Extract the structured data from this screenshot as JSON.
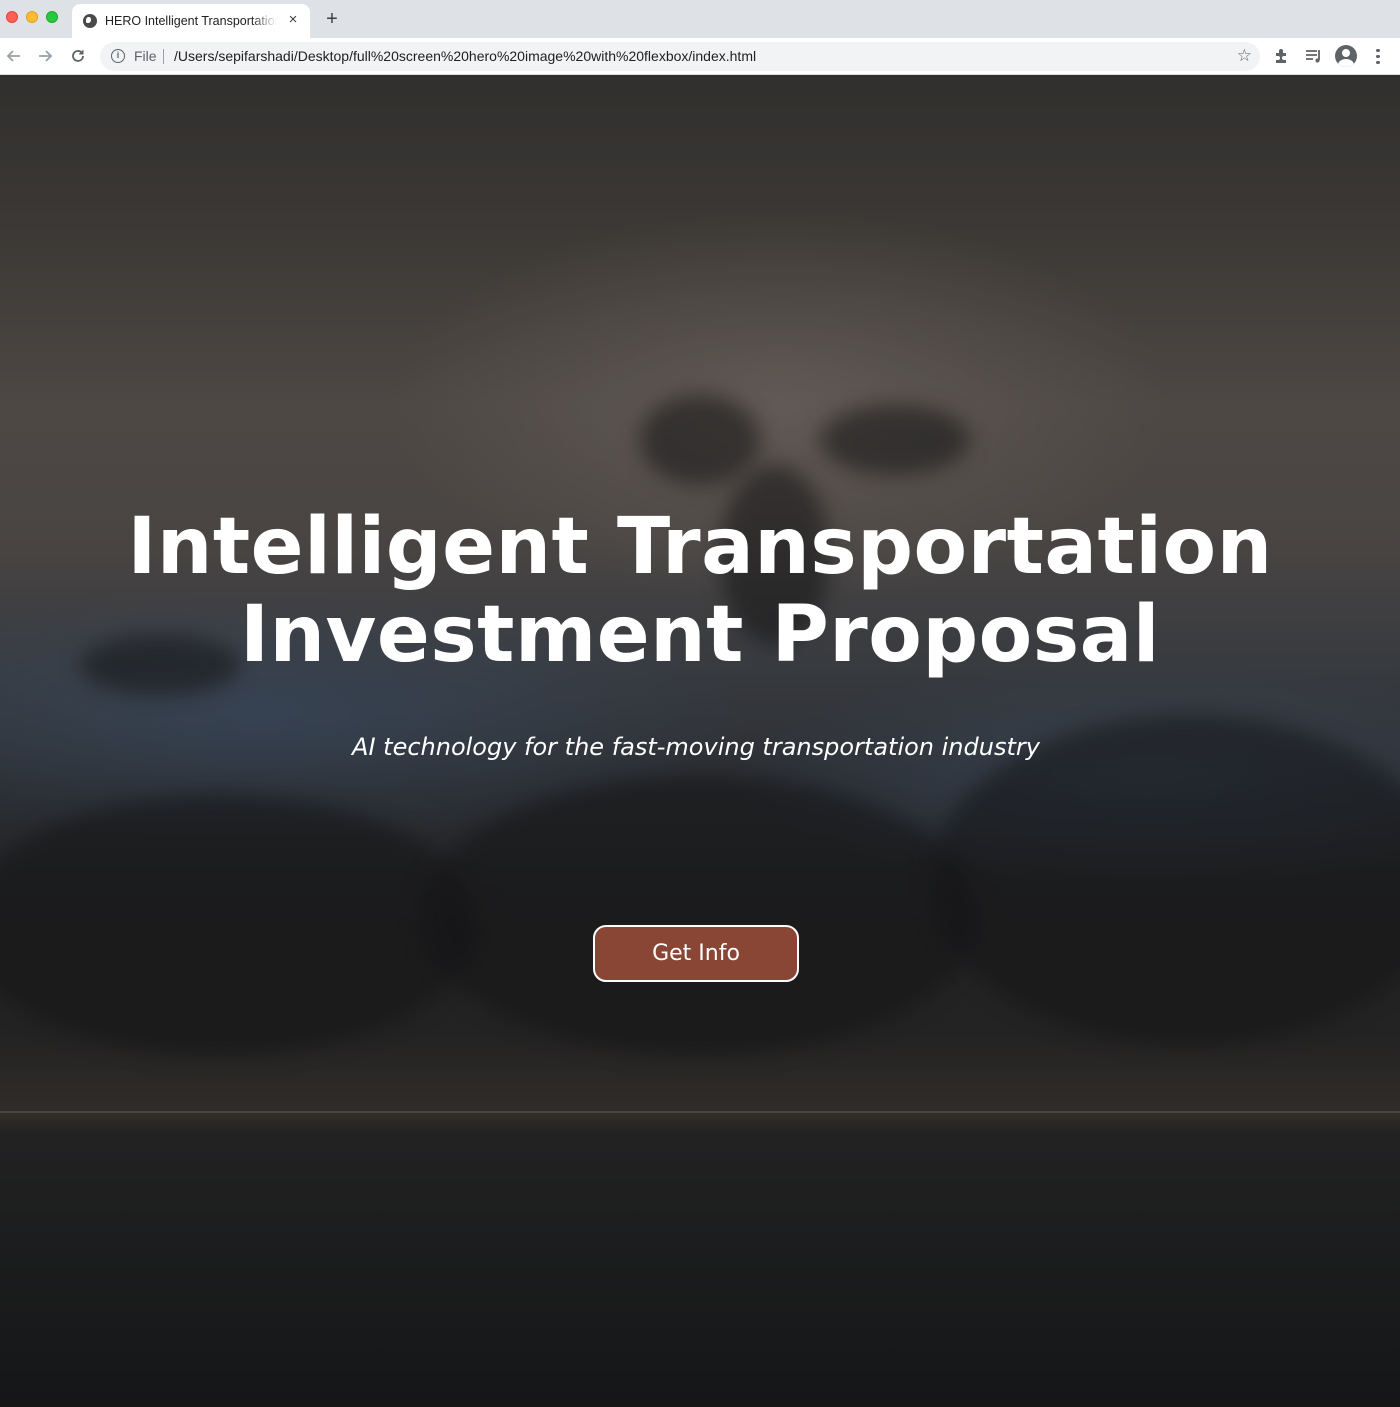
{
  "browser": {
    "tab_title": "HERO Intelligent Transportation Investment Proposal",
    "tab_close_glyph": "×",
    "new_tab_glyph": "+",
    "scheme_label": "File",
    "url": "/Users/sepifarshadi/Desktop/full%20screen%20hero%20image%20with%20flexbox/index.html",
    "icons": {
      "back": "arrow-left-icon",
      "forward": "arrow-right-icon",
      "reload": "reload-icon",
      "info": "info-icon",
      "bookmark": "star-icon",
      "extensions": "puzzle-icon",
      "media": "media-control-icon",
      "profile": "profile-icon",
      "menu": "kebab-menu-icon"
    }
  },
  "hero": {
    "title_line1": "Intelligent Transportation",
    "title_line2": "Investment Proposal",
    "subtitle": "AI technology for the fast-moving transportation industry",
    "cta_label": "Get Info"
  },
  "colors": {
    "cta_background": "#8a4634",
    "cta_border": "#ffffff",
    "text": "#ffffff"
  }
}
